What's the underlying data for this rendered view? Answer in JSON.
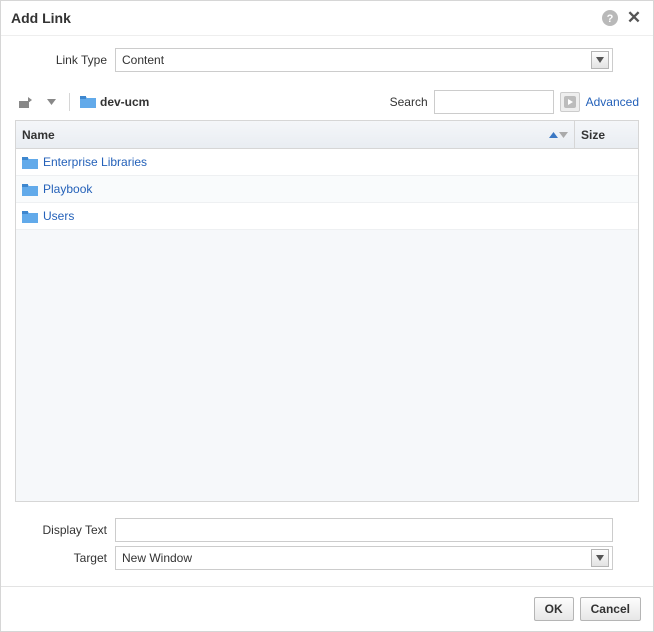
{
  "dialog": {
    "title": "Add Link"
  },
  "linkType": {
    "label": "Link Type",
    "value": "Content"
  },
  "breadcrumb": {
    "current": "dev-ucm"
  },
  "search": {
    "label": "Search",
    "value": "",
    "advanced": "Advanced"
  },
  "columns": {
    "name": "Name",
    "size": "Size"
  },
  "rows": [
    {
      "label": "Enterprise Libraries"
    },
    {
      "label": "Playbook"
    },
    {
      "label": "Users"
    }
  ],
  "displayText": {
    "label": "Display Text",
    "value": ""
  },
  "target": {
    "label": "Target",
    "value": "New Window"
  },
  "buttons": {
    "ok": "OK",
    "cancel": "Cancel"
  }
}
